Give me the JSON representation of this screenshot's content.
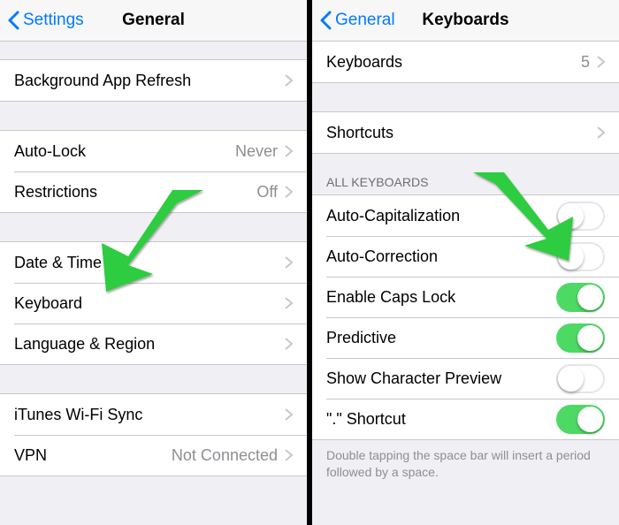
{
  "left": {
    "nav": {
      "back": "Settings",
      "title": "General"
    },
    "groups": [
      {
        "cells": [
          {
            "label": "Background App Refresh"
          }
        ]
      },
      {
        "cells": [
          {
            "label": "Auto-Lock",
            "value": "Never"
          },
          {
            "label": "Restrictions",
            "value": "Off"
          }
        ]
      },
      {
        "cells": [
          {
            "label": "Date & Time"
          },
          {
            "label": "Keyboard"
          },
          {
            "label": "Language & Region"
          }
        ]
      },
      {
        "cells": [
          {
            "label": "iTunes Wi-Fi Sync"
          },
          {
            "label": "VPN",
            "value": "Not Connected"
          }
        ]
      }
    ]
  },
  "right": {
    "nav": {
      "back": "General",
      "title": "Keyboards"
    },
    "top_cell": {
      "label": "Keyboards",
      "value": "5"
    },
    "shortcuts_cell": {
      "label": "Shortcuts"
    },
    "section_header": "ALL KEYBOARDS",
    "switches": [
      {
        "label": "Auto-Capitalization",
        "on": false
      },
      {
        "label": "Auto-Correction",
        "on": false
      },
      {
        "label": "Enable Caps Lock",
        "on": true
      },
      {
        "label": "Predictive",
        "on": true
      },
      {
        "label": "Show Character Preview",
        "on": false
      },
      {
        "label": "\".\" Shortcut",
        "on": true
      }
    ],
    "footer": "Double tapping the space bar will insert a period followed by a space."
  },
  "annotation_color": "#2ecc40"
}
